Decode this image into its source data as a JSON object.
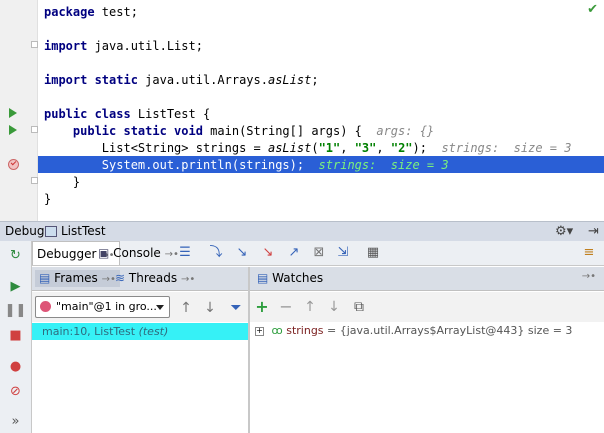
{
  "editor": {
    "lines": [
      {
        "id": "package",
        "parts": [
          {
            "t": "package",
            "c": "kw"
          },
          {
            "t": " test;"
          }
        ]
      },
      {
        "id": "import1",
        "parts": [
          {
            "t": "import",
            "c": "kw"
          },
          {
            "t": " java.util.List;"
          }
        ]
      },
      {
        "id": "import2",
        "parts": [
          {
            "t": "import static",
            "c": "kw"
          },
          {
            "t": " java.util.Arrays."
          },
          {
            "t": "asList",
            "c": "it"
          },
          {
            "t": ";"
          }
        ]
      },
      {
        "id": "classdecl",
        "parts": [
          {
            "t": "public class",
            "c": "kw"
          },
          {
            "t": " ListTest {"
          }
        ]
      },
      {
        "id": "maindecl",
        "parts": [
          {
            "t": "    "
          },
          {
            "t": "public static void",
            "c": "kw"
          },
          {
            "t": " main(String[] args) {  "
          },
          {
            "t": "args: {}",
            "c": "hint"
          }
        ]
      },
      {
        "id": "listdecl",
        "parts": [
          {
            "t": "        List<String> strings = "
          },
          {
            "t": "asList",
            "c": "it"
          },
          {
            "t": "("
          },
          {
            "t": "\"1\"",
            "c": "str"
          },
          {
            "t": ", "
          },
          {
            "t": "\"3\"",
            "c": "str"
          },
          {
            "t": ", "
          },
          {
            "t": "\"2\"",
            "c": "str"
          },
          {
            "t": ");  "
          },
          {
            "t": "strings:  size = 3",
            "c": "hint"
          }
        ]
      },
      {
        "id": "println",
        "parts": [
          {
            "t": "        System.out.println(strings);  ",
            "c": "hl-text"
          },
          {
            "t": "strings:  size = 3",
            "c": "hl-hint"
          }
        ]
      },
      {
        "id": "close1",
        "parts": [
          {
            "t": "    }"
          }
        ]
      },
      {
        "id": "close2",
        "parts": [
          {
            "t": "}"
          }
        ]
      }
    ]
  },
  "debug": {
    "label": "Debug",
    "tab_title": "ListTest"
  },
  "tabs": {
    "debugger": "Debugger",
    "console": "Console"
  },
  "frames": {
    "title": "Frames",
    "threads_title": "Threads",
    "thread_selected": "\"main\"@1 in gro...",
    "rows": [
      {
        "location": "main:10, ListTest",
        "class_hint": "(test)"
      }
    ]
  },
  "watches": {
    "title": "Watches",
    "items": [
      {
        "name": "strings",
        "value": "= {java.util.Arrays$ArrayList@443}  size = 3"
      }
    ]
  },
  "icons": {
    "rerun": "rerun-icon",
    "resume": "resume-icon",
    "pause": "pause-icon",
    "stop": "stop-icon",
    "view_breakpoints": "view-breakpoints-icon",
    "mute_breakpoints": "mute-breakpoints-icon",
    "settings": "gear-icon",
    "hide": "hide-icon"
  },
  "colors": {
    "current_line": "#2a5fd6",
    "selected_frame": "#36f1f6",
    "run_icon": "#3a9a3a"
  }
}
